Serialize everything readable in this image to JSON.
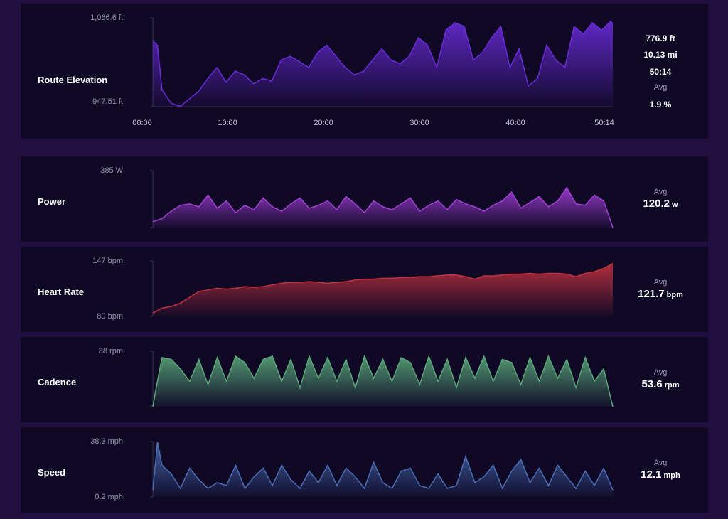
{
  "colors": {
    "page_bg": "#21103f",
    "panel_bg": "#0f0926",
    "elevation": "#6a2bd9",
    "power": "#a43fd8",
    "heart_rate": "#c2323f",
    "cadence": "#5aa77a",
    "speed": "#4a6fb8"
  },
  "elevation": {
    "label": "Route Elevation",
    "y_max_label": "1,066.6 ft",
    "y_min_label": "947.51 ft",
    "x_ticks": [
      "00:00",
      "10:00",
      "20:00",
      "30:00",
      "40:00",
      "50:14"
    ],
    "stats": {
      "gain": "776.9 ft",
      "distance": "10.13 mi",
      "time": "50:14",
      "avg_label": "Avg",
      "grade": "1.9 %"
    }
  },
  "power": {
    "label": "Power",
    "y_max_label": "385 W",
    "avg_label": "Avg",
    "avg_value": "120.2",
    "avg_unit": "w"
  },
  "heart_rate": {
    "label": "Heart Rate",
    "y_max_label": "147 bpm",
    "y_min_label": "80 bpm",
    "avg_label": "Avg",
    "avg_value": "121.7",
    "avg_unit": "bpm"
  },
  "cadence": {
    "label": "Cadence",
    "y_max_label": "88 rpm",
    "avg_label": "Avg",
    "avg_value": "53.6",
    "avg_unit": "rpm"
  },
  "speed": {
    "label": "Speed",
    "y_max_label": "38.3 mph",
    "y_min_label": "0.2 mph",
    "avg_label": "Avg",
    "avg_value": "12.1",
    "avg_unit": "mph"
  },
  "chart_data": [
    {
      "type": "area",
      "title": "Route Elevation",
      "x_unit": "minutes",
      "y_unit": "ft",
      "ylim": [
        947.51,
        1066.6
      ],
      "x": [
        0,
        0.5,
        1,
        2,
        3,
        4,
        5,
        6,
        7,
        8,
        9,
        10,
        11,
        12,
        13,
        14,
        15,
        16,
        17,
        18,
        19,
        20,
        21,
        22,
        23,
        24,
        25,
        26,
        27,
        28,
        29,
        30,
        31,
        32,
        33,
        34,
        35,
        36,
        37,
        38,
        39,
        40,
        41,
        42,
        43,
        44,
        45,
        46,
        47,
        48,
        49,
        50,
        50.23
      ],
      "values": [
        1036,
        1030,
        970,
        952,
        948,
        958,
        968,
        985,
        1000,
        980,
        995,
        990,
        978,
        985,
        982,
        1010,
        1015,
        1008,
        1000,
        1020,
        1030,
        1015,
        1000,
        990,
        995,
        1010,
        1025,
        1010,
        1005,
        1015,
        1040,
        1030,
        1000,
        1050,
        1060,
        1055,
        1010,
        1020,
        1040,
        1055,
        1000,
        1025,
        975,
        985,
        1030,
        1010,
        1000,
        1055,
        1045,
        1060,
        1050,
        1062,
        1058
      ]
    },
    {
      "type": "area",
      "title": "Power",
      "y_unit": "W",
      "ylim": [
        0,
        385
      ],
      "x": [
        0,
        1,
        2,
        3,
        4,
        5,
        6,
        7,
        8,
        9,
        10,
        11,
        12,
        13,
        14,
        15,
        16,
        17,
        18,
        19,
        20,
        21,
        22,
        23,
        24,
        25,
        26,
        27,
        28,
        29,
        30,
        31,
        32,
        33,
        34,
        35,
        36,
        37,
        38,
        39,
        40,
        41,
        42,
        43,
        44,
        45,
        46,
        47,
        48,
        49,
        50
      ],
      "values": [
        40,
        60,
        110,
        150,
        160,
        140,
        220,
        130,
        180,
        100,
        150,
        120,
        200,
        140,
        110,
        160,
        200,
        130,
        150,
        180,
        120,
        210,
        160,
        100,
        180,
        140,
        120,
        160,
        200,
        110,
        150,
        180,
        120,
        190,
        160,
        140,
        110,
        150,
        180,
        240,
        130,
        170,
        210,
        140,
        180,
        270,
        160,
        150,
        220,
        180,
        0
      ]
    },
    {
      "type": "area",
      "title": "Heart Rate",
      "y_unit": "bpm",
      "ylim": [
        80,
        147
      ],
      "x": [
        0,
        1,
        2,
        3,
        4,
        5,
        6,
        7,
        8,
        9,
        10,
        11,
        12,
        13,
        14,
        15,
        16,
        17,
        18,
        19,
        20,
        21,
        22,
        23,
        24,
        25,
        26,
        27,
        28,
        29,
        30,
        31,
        32,
        33,
        34,
        35,
        36,
        37,
        38,
        39,
        40,
        41,
        42,
        43,
        44,
        45,
        46,
        47,
        48,
        49,
        50
      ],
      "values": [
        84,
        90,
        92,
        96,
        103,
        110,
        112,
        114,
        113,
        114,
        116,
        115,
        116,
        118,
        120,
        121,
        121,
        122,
        121,
        120,
        121,
        122,
        124,
        125,
        125,
        126,
        126,
        127,
        127,
        128,
        128,
        129,
        130,
        130,
        128,
        125,
        129,
        129,
        130,
        131,
        131,
        132,
        131,
        132,
        132,
        131,
        128,
        132,
        134,
        138,
        144
      ]
    },
    {
      "type": "area",
      "title": "Cadence",
      "y_unit": "rpm",
      "ylim": [
        0,
        88
      ],
      "x": [
        0,
        0.3,
        1,
        2,
        3,
        4,
        5,
        6,
        7,
        8,
        9,
        10,
        11,
        12,
        13,
        14,
        15,
        16,
        17,
        18,
        19,
        20,
        21,
        22,
        23,
        24,
        25,
        26,
        27,
        28,
        29,
        30,
        31,
        32,
        33,
        34,
        35,
        36,
        37,
        38,
        39,
        40,
        41,
        42,
        43,
        44,
        45,
        46,
        47,
        48,
        49,
        50
      ],
      "values": [
        0,
        25,
        78,
        75,
        60,
        40,
        75,
        35,
        78,
        40,
        80,
        70,
        45,
        75,
        80,
        40,
        75,
        30,
        80,
        45,
        78,
        40,
        75,
        30,
        80,
        45,
        75,
        40,
        78,
        70,
        35,
        80,
        40,
        75,
        30,
        78,
        45,
        80,
        40,
        75,
        70,
        35,
        78,
        40,
        80,
        45,
        75,
        30,
        78,
        40,
        60,
        0
      ]
    },
    {
      "type": "area",
      "title": "Speed",
      "y_unit": "mph",
      "ylim": [
        0.2,
        38.3
      ],
      "x": [
        0,
        0.5,
        1,
        2,
        3,
        4,
        5,
        6,
        7,
        8,
        9,
        10,
        11,
        12,
        13,
        14,
        15,
        16,
        17,
        18,
        19,
        20,
        21,
        22,
        23,
        24,
        25,
        26,
        27,
        28,
        29,
        30,
        31,
        32,
        33,
        34,
        35,
        36,
        37,
        38,
        39,
        40,
        41,
        42,
        43,
        44,
        45,
        46,
        47,
        48,
        49,
        50
      ],
      "values": [
        5,
        38,
        22,
        16,
        6,
        20,
        12,
        6,
        10,
        8,
        22,
        6,
        14,
        20,
        8,
        22,
        12,
        6,
        18,
        10,
        22,
        8,
        20,
        14,
        6,
        24,
        10,
        6,
        18,
        20,
        8,
        6,
        16,
        6,
        8,
        28,
        10,
        14,
        22,
        6,
        18,
        26,
        10,
        20,
        8,
        22,
        14,
        6,
        18,
        8,
        20,
        5
      ]
    }
  ]
}
